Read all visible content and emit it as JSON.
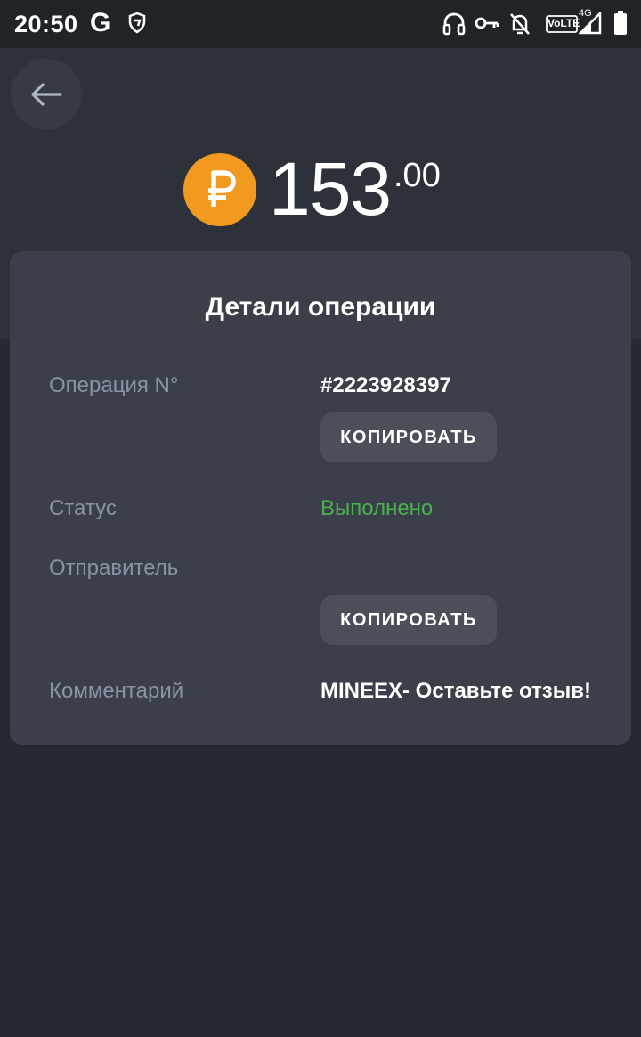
{
  "status_bar": {
    "time": "20:50",
    "g_label": "G",
    "volte_label": "VoLTE",
    "network_label": "4G"
  },
  "icons": {
    "back": "arrow-left-icon",
    "currency": "ruble-icon"
  },
  "amount": {
    "integer": "153",
    "fraction": ".00",
    "currency_symbol": "₽"
  },
  "details": {
    "title": "Детали операции",
    "rows": [
      {
        "label": "Операция N°",
        "value": "#2223928397",
        "copy_label": "КОПИРОВАТЬ"
      },
      {
        "label": "Статус",
        "value": "Выполнено"
      },
      {
        "label": "Отправитель",
        "value": "",
        "copy_label": "КОПИРОВАТЬ"
      },
      {
        "label": "Комментарий",
        "value": "MINEEX- Оставьте отзыв!"
      }
    ]
  },
  "colors": {
    "background": "#252930",
    "card": "#3a3f4a",
    "accent_orange": "#f29a1f",
    "success_green": "#4caf50",
    "label_gray": "#8a93a6"
  }
}
